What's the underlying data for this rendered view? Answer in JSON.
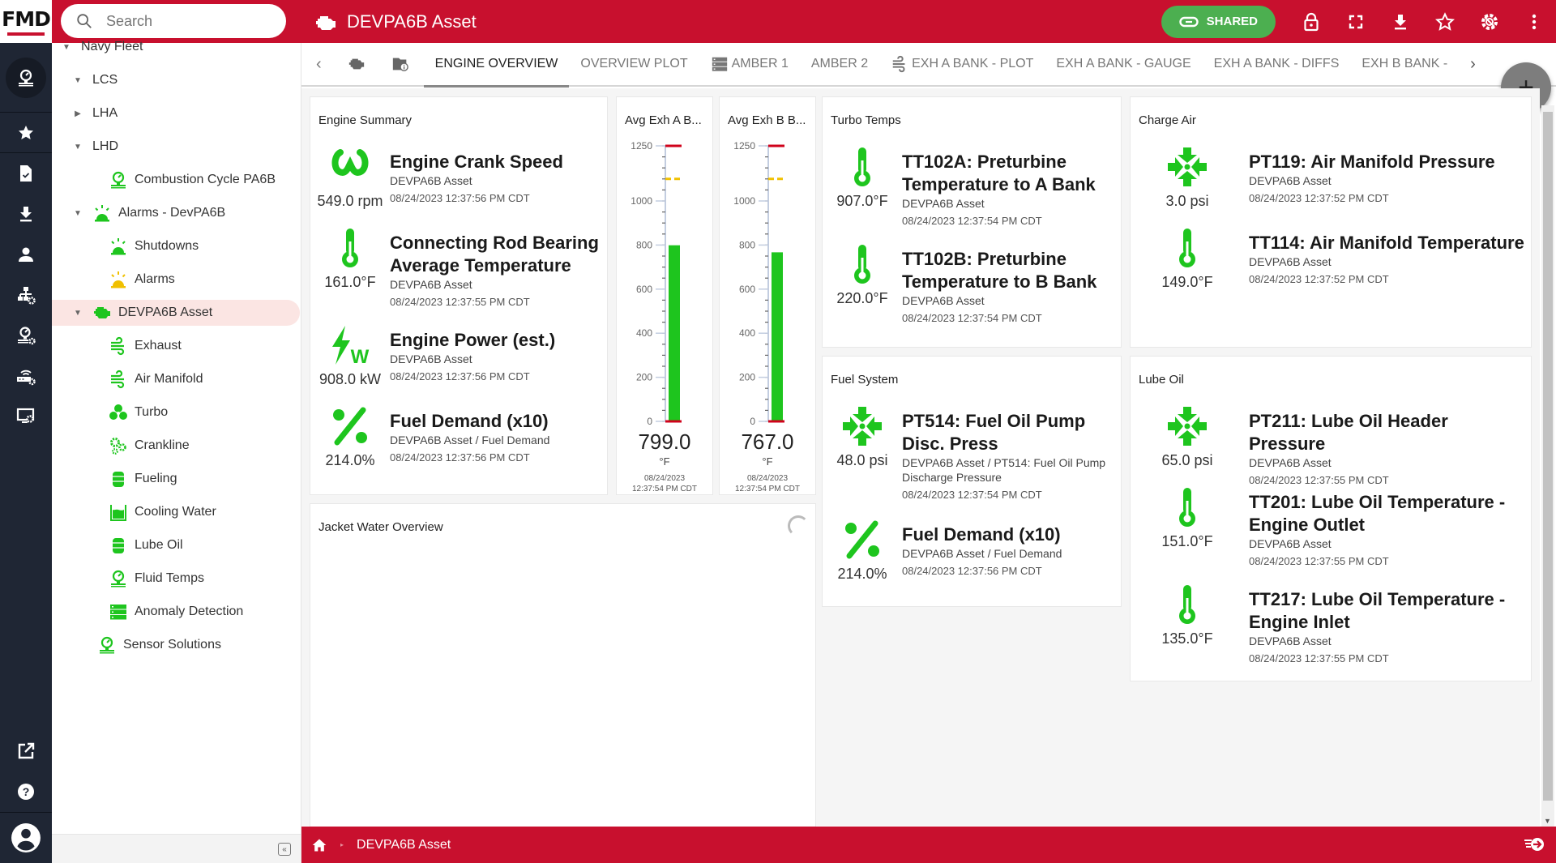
{
  "header": {
    "logo": "FMD",
    "search_placeholder": "Search",
    "title": "DEVPA6B Asset",
    "shared_label": "SHARED",
    "icons": [
      "lock-icon",
      "fullscreen-icon",
      "download-icon",
      "star-icon",
      "settings-icon",
      "more-vert-icon"
    ]
  },
  "leftnav": {
    "items": [
      "gauge-icon",
      "star-icon",
      "document-check-icon",
      "download-icon",
      "user-icon",
      "hierarchy-settings-icon",
      "gauge-settings-icon",
      "router-settings-icon",
      "monitor-settings-icon"
    ],
    "bottom": [
      "open-external-icon",
      "help-icon",
      "account-icon"
    ]
  },
  "tree": {
    "items": [
      {
        "label": "Navy Fleet",
        "caret": "down",
        "icon": ""
      },
      {
        "label": "LCS",
        "caret": "down",
        "icon": ""
      },
      {
        "label": "LHA",
        "caret": "right",
        "icon": ""
      },
      {
        "label": "LHD",
        "caret": "down",
        "icon": ""
      },
      {
        "label": "Combustion Cycle PA6B",
        "caret": "",
        "icon": "gauge"
      },
      {
        "label": "Alarms - DevPA6B",
        "caret": "down",
        "icon": "alarm-green"
      },
      {
        "label": "Shutdowns",
        "caret": "",
        "icon": "alarm-green"
      },
      {
        "label": "Alarms",
        "caret": "",
        "icon": "alarm-yellow"
      },
      {
        "label": "DEVPA6B Asset",
        "caret": "down",
        "icon": "engine",
        "selected": true
      },
      {
        "label": "Exhaust",
        "caret": "",
        "icon": "wind"
      },
      {
        "label": "Air Manifold",
        "caret": "",
        "icon": "wind"
      },
      {
        "label": "Turbo",
        "caret": "",
        "icon": "fan"
      },
      {
        "label": "Crankline",
        "caret": "",
        "icon": "gears"
      },
      {
        "label": "Fueling",
        "caret": "",
        "icon": "barrel"
      },
      {
        "label": "Cooling Water",
        "caret": "",
        "icon": "tank"
      },
      {
        "label": "Lube Oil",
        "caret": "",
        "icon": "barrel"
      },
      {
        "label": "Fluid Temps",
        "caret": "",
        "icon": "gauge"
      },
      {
        "label": "Anomaly Detection",
        "caret": "",
        "icon": "server"
      },
      {
        "label": "Sensor Solutions",
        "caret": "",
        "icon": "gauge"
      }
    ]
  },
  "tabs": [
    {
      "label": "",
      "icon": "engine-icon"
    },
    {
      "label": "",
      "icon": "folder-info-icon"
    },
    {
      "label": "ENGINE OVERVIEW",
      "active": true
    },
    {
      "label": "OVERVIEW PLOT"
    },
    {
      "label": "AMBER 1",
      "icon": "server-icon"
    },
    {
      "label": "AMBER 2"
    },
    {
      "label": "EXH A BANK - PLOT",
      "icon": "wind-icon"
    },
    {
      "label": "EXH A BANK - GAUGE"
    },
    {
      "label": "EXH A BANK - DIFFS"
    },
    {
      "label": "EXH B BANK -"
    }
  ],
  "colors": {
    "brand": "#c8102e",
    "ok": "#1ec51e",
    "warn": "#f0c000",
    "alarm": "#d0021b"
  },
  "cards": {
    "engine_summary": {
      "title": "Engine Summary",
      "metrics": [
        {
          "icon": "omega",
          "value": "549.0 rpm",
          "name": "Engine Crank Speed",
          "sub": "DEVPA6B Asset",
          "ts": "08/24/2023 12:37:56 PM CDT"
        },
        {
          "icon": "thermometer",
          "value": "161.0°F",
          "name": "Connecting Rod Bearing Average Temperature",
          "sub": "DEVPA6B Asset",
          "ts": "08/24/2023 12:37:55 PM CDT"
        },
        {
          "icon": "power",
          "value": "908.0 kW",
          "name": "Engine Power (est.)",
          "sub": "DEVPA6B Asset",
          "ts": "08/24/2023 12:37:56 PM CDT"
        },
        {
          "icon": "percent",
          "value": "214.0%",
          "name": "Fuel Demand (x10)",
          "sub": "DEVPA6B Asset / Fuel Demand",
          "ts": "08/24/2023 12:37:56 PM CDT"
        }
      ]
    },
    "gauge_a": {
      "title": "Avg Exh A B...",
      "value": "799.0",
      "unit": "°F",
      "ts_date": "08/24/2023",
      "ts_time": "12:37:54 PM CDT"
    },
    "gauge_b": {
      "title": "Avg Exh B B...",
      "value": "767.0",
      "unit": "°F",
      "ts_date": "08/24/2023",
      "ts_time": "12:37:54 PM CDT"
    },
    "turbo": {
      "title": "Turbo Temps",
      "metrics": [
        {
          "icon": "thermometer",
          "value": "907.0°F",
          "name": "TT102A: Preturbine Temperature to A Bank",
          "sub": "DEVPA6B Asset",
          "ts": "08/24/2023 12:37:54 PM CDT"
        },
        {
          "icon": "thermometer",
          "value": "220.0°F",
          "name": "TT102B: Preturbine Temperature to B Bank",
          "sub": "DEVPA6B Asset",
          "ts": "08/24/2023 12:37:54 PM CDT"
        }
      ]
    },
    "charge_air": {
      "title": "Charge Air",
      "metrics": [
        {
          "icon": "pressure",
          "value": "3.0 psi",
          "name": "PT119: Air Manifold Pressure",
          "sub": "DEVPA6B Asset",
          "ts": "08/24/2023 12:37:52 PM CDT"
        },
        {
          "icon": "thermometer",
          "value": "149.0°F",
          "name": "TT114: Air Manifold Temperature",
          "sub": "DEVPA6B Asset",
          "ts": "08/24/2023 12:37:52 PM CDT"
        }
      ]
    },
    "fuel": {
      "title": "Fuel System",
      "metrics": [
        {
          "icon": "pressure",
          "value": "48.0 psi",
          "name": "PT514: Fuel Oil Pump Disc. Press",
          "sub": "DEVPA6B Asset / PT514: Fuel Oil Pump Discharge Pressure",
          "ts": "08/24/2023 12:37:54 PM CDT"
        },
        {
          "icon": "percent",
          "value": "214.0%",
          "name": "Fuel Demand (x10)",
          "sub": "DEVPA6B Asset / Fuel Demand",
          "ts": "08/24/2023 12:37:56 PM CDT"
        }
      ]
    },
    "lube": {
      "title": "Lube Oil",
      "metrics": [
        {
          "icon": "pressure",
          "value": "65.0 psi",
          "name": "PT211: Lube Oil Header Pressure",
          "sub": "DEVPA6B Asset",
          "ts": "08/24/2023 12:37:55 PM CDT"
        },
        {
          "icon": "thermometer",
          "value": "151.0°F",
          "name": "TT201: Lube Oil Temperature - Engine Outlet",
          "sub": "DEVPA6B Asset",
          "ts": "08/24/2023 12:37:55 PM CDT"
        },
        {
          "icon": "thermometer",
          "value": "135.0°F",
          "name": "TT217: Lube Oil Temperature - Engine Inlet",
          "sub": "DEVPA6B Asset",
          "ts": "08/24/2023 12:37:55 PM CDT"
        }
      ]
    },
    "jacket": {
      "title": "Jacket Water Overview"
    }
  },
  "chart_data": [
    {
      "type": "bar",
      "title": "Avg Exh A B...",
      "values": [
        799.0
      ],
      "unit": "°F",
      "ylim": [
        0,
        1250
      ],
      "ticks": [
        0,
        200,
        400,
        600,
        800,
        1000,
        1250
      ],
      "alarm_high": 1250,
      "warn_high": 1100,
      "alarm_low": 0
    },
    {
      "type": "bar",
      "title": "Avg Exh B B...",
      "values": [
        767.0
      ],
      "unit": "°F",
      "ylim": [
        0,
        1250
      ],
      "ticks": [
        0,
        200,
        400,
        600,
        800,
        1000,
        1250
      ],
      "alarm_high": 1250,
      "warn_high": 1100,
      "alarm_low": 0
    }
  ],
  "footer": {
    "breadcrumb": "DEVPA6B Asset"
  }
}
